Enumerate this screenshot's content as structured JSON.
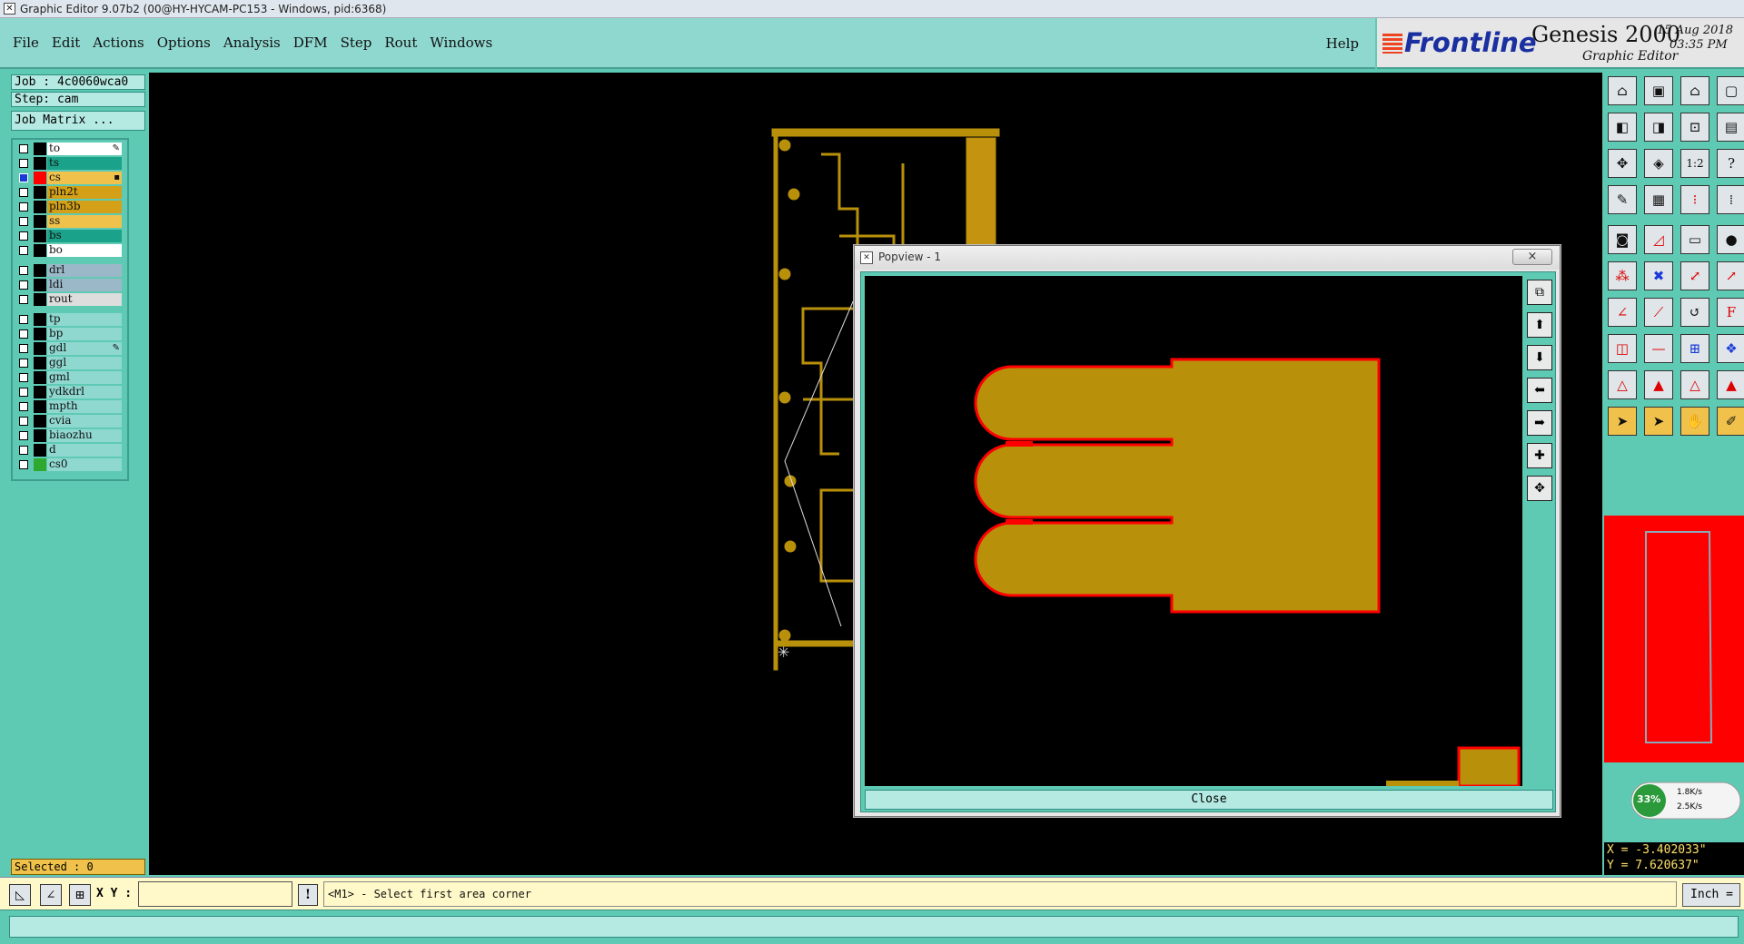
{
  "window": {
    "title": "Graphic Editor 9.07b2 (00@HY-HYCAM-PC153 - Windows, pid:6368)"
  },
  "menu": {
    "items": [
      "File",
      "Edit",
      "Actions",
      "Options",
      "Analysis",
      "DFM",
      "Step",
      "Rout",
      "Windows"
    ],
    "help": "Help"
  },
  "brand": {
    "logo": "Frontline",
    "product": "Genesis 2000",
    "subtitle": "Graphic Editor",
    "date": "15 Aug 2018",
    "time": "03:35 PM"
  },
  "job": {
    "job_label": "Job : 4c0060wca0",
    "step_label": "Step: cam",
    "matrix_button": "Job Matrix ..."
  },
  "layers": [
    {
      "name": "to",
      "color": "#ffffff",
      "selected": false,
      "swatch": "#000000",
      "marker": "✎"
    },
    {
      "name": "ts",
      "color": "#1aa38a",
      "selected": false,
      "swatch": "#000000",
      "marker": ""
    },
    {
      "name": "cs",
      "color": "#f0c24b",
      "selected": true,
      "swatch": "#ff0000",
      "marker": "▪"
    },
    {
      "name": "pln2t",
      "color": "#d4a017",
      "selected": false,
      "swatch": "#000000",
      "marker": ""
    },
    {
      "name": "pln3b",
      "color": "#d4a017",
      "selected": false,
      "swatch": "#000000",
      "marker": ""
    },
    {
      "name": "ss",
      "color": "#f0c24b",
      "selected": false,
      "swatch": "#000000",
      "marker": ""
    },
    {
      "name": "bs",
      "color": "#1aa38a",
      "selected": false,
      "swatch": "#000000",
      "marker": ""
    },
    {
      "name": "bo",
      "color": "#ffffff",
      "selected": false,
      "swatch": "#000000",
      "marker": ""
    },
    {
      "name": "drl",
      "color": "#9ab8c8",
      "selected": false,
      "swatch": "#000000",
      "marker": "",
      "gap": true
    },
    {
      "name": "ldi",
      "color": "#9ab8c8",
      "selected": false,
      "swatch": "#000000",
      "marker": ""
    },
    {
      "name": "rout",
      "color": "#dddddd",
      "selected": false,
      "swatch": "#000000",
      "marker": ""
    },
    {
      "name": "tp",
      "color": "#8fd8d0",
      "selected": false,
      "swatch": "#000000",
      "marker": "",
      "gap": true
    },
    {
      "name": "bp",
      "color": "#8fd8d0",
      "selected": false,
      "swatch": "#000000",
      "marker": ""
    },
    {
      "name": "gdl",
      "color": "#8fd8d0",
      "selected": false,
      "swatch": "#000000",
      "marker": "✎"
    },
    {
      "name": "ggl",
      "color": "#8fd8d0",
      "selected": false,
      "swatch": "#000000",
      "marker": ""
    },
    {
      "name": "gml",
      "color": "#8fd8d0",
      "selected": false,
      "swatch": "#000000",
      "marker": ""
    },
    {
      "name": "ydkdrl",
      "color": "#8fd8d0",
      "selected": false,
      "swatch": "#000000",
      "marker": ""
    },
    {
      "name": "mpth",
      "color": "#8fd8d0",
      "selected": false,
      "swatch": "#000000",
      "marker": ""
    },
    {
      "name": "cvia",
      "color": "#8fd8d0",
      "selected": false,
      "swatch": "#000000",
      "marker": ""
    },
    {
      "name": "biaozhu",
      "color": "#8fd8d0",
      "selected": false,
      "swatch": "#000000",
      "marker": ""
    },
    {
      "name": "d",
      "color": "#8fd8d0",
      "selected": false,
      "swatch": "#000000",
      "marker": ""
    },
    {
      "name": "cs0",
      "color": "#8fd8d0",
      "selected": false,
      "swatch": "#2fa82f",
      "marker": ""
    }
  ],
  "selected": "Selected : 0",
  "popview": {
    "title": "Popview - 1",
    "close_x": "×",
    "close_button": "Close"
  },
  "speed": {
    "percent": "33%",
    "up": "1.8K/s",
    "down": "2.5K/s"
  },
  "coords": {
    "x": "X = -3.402033\"",
    "y": "Y = 7.620637\""
  },
  "bottom": {
    "xy_label": "X Y :",
    "xy_value": "",
    "bang": "!",
    "prompt": "<M1> - Select first area corner",
    "units": "Inch ="
  },
  "colors": {
    "pcb": "#b8900a",
    "red": "#ff0000",
    "panel": "#5fcab4"
  }
}
